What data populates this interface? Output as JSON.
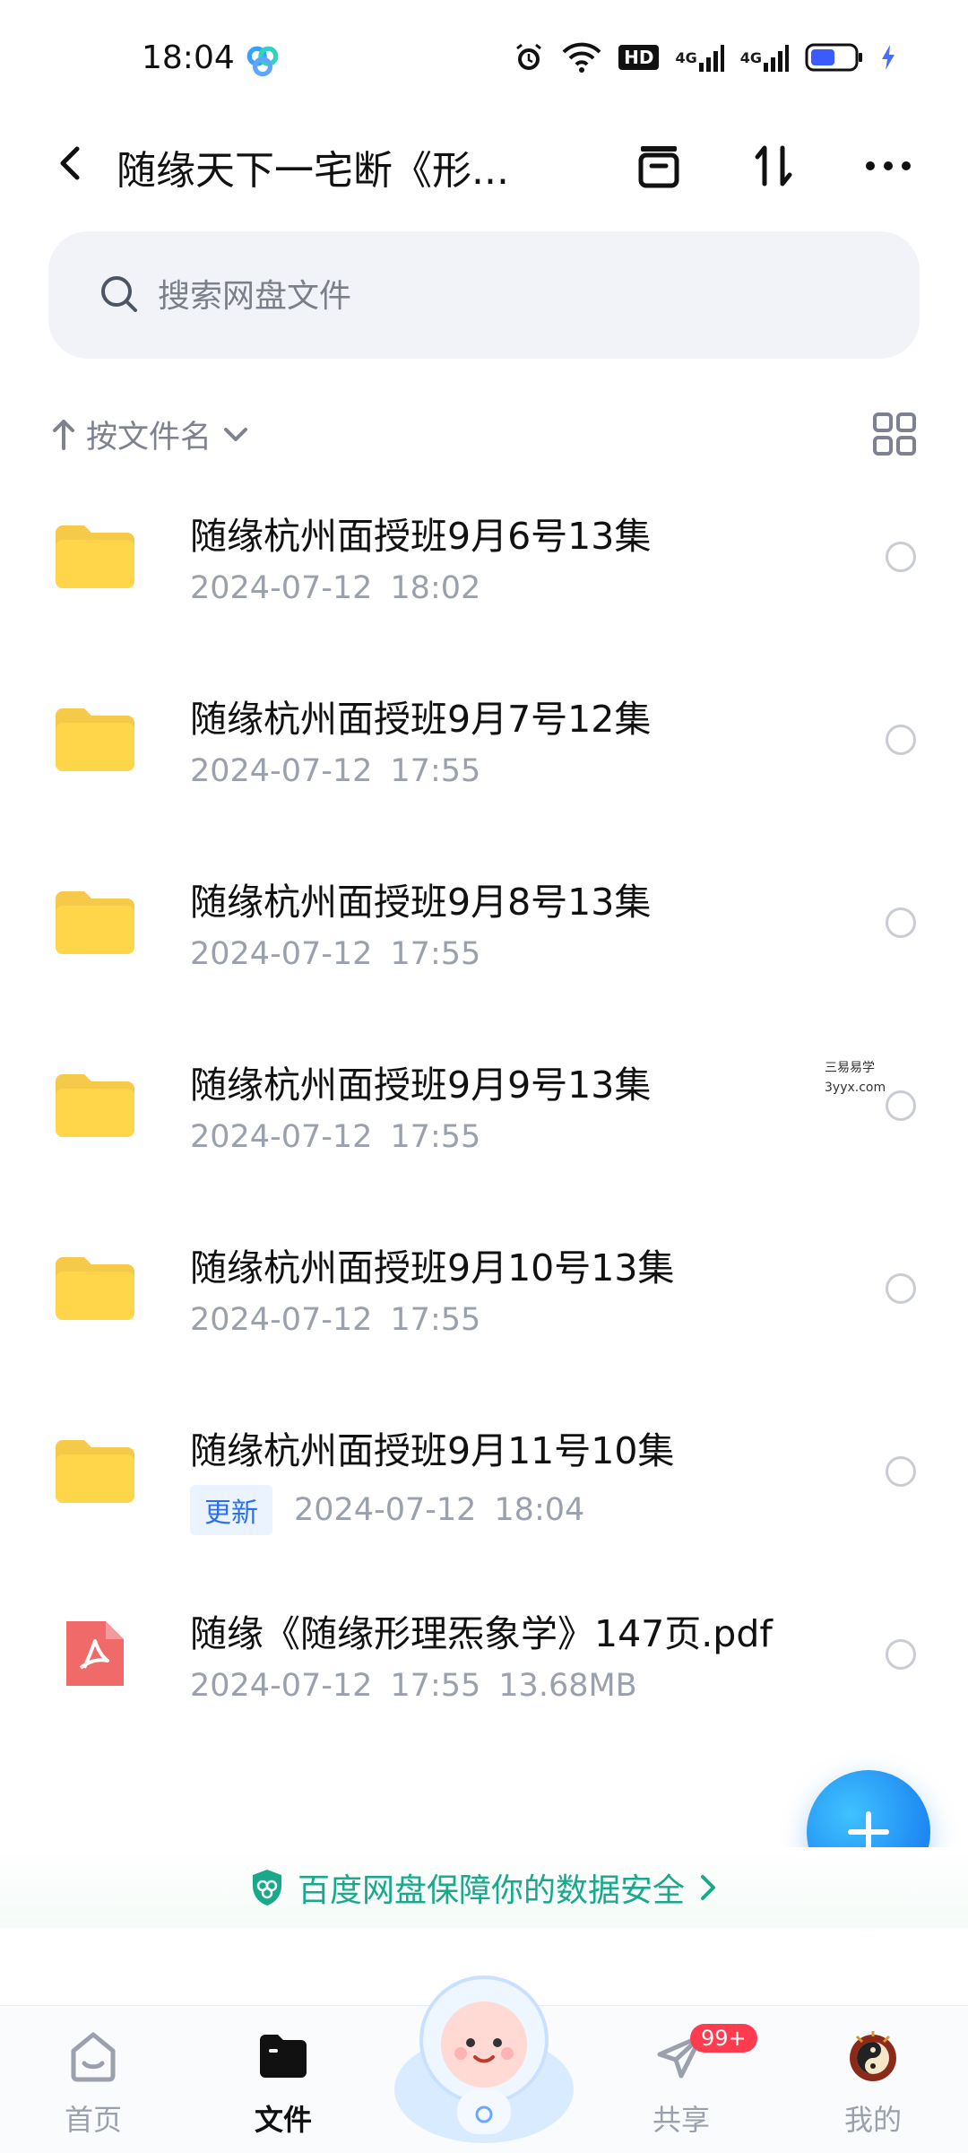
{
  "status_bar": {
    "time": "18:04",
    "app_icon": "baidu-netdisk-icon",
    "icons": [
      "alarm-icon",
      "wifi-icon",
      "hd-icon",
      "signal-4g-icon",
      "signal-4g-icon",
      "battery-icon",
      "charging-icon"
    ],
    "hd_label": "HD",
    "net1": "4G",
    "net2": "4G"
  },
  "header": {
    "title": "随缘天下一宅断《形...",
    "buttons": [
      "archive-icon",
      "sort-icon",
      "more-icon"
    ]
  },
  "search": {
    "placeholder": "搜索网盘文件"
  },
  "sort": {
    "label": "按文件名"
  },
  "files": [
    {
      "name": "随缘杭州面授班9月6号13集",
      "date": "2024-07-12",
      "time": "18:02",
      "type": "folder"
    },
    {
      "name": "随缘杭州面授班9月7号12集",
      "date": "2024-07-12",
      "time": "17:55",
      "type": "folder"
    },
    {
      "name": "随缘杭州面授班9月8号13集",
      "date": "2024-07-12",
      "time": "17:55",
      "type": "folder"
    },
    {
      "name": "随缘杭州面授班9月9号13集",
      "date": "2024-07-12",
      "time": "17:55",
      "type": "folder"
    },
    {
      "name": "随缘杭州面授班9月10号13集",
      "date": "2024-07-12",
      "time": "17:55",
      "type": "folder"
    },
    {
      "name": "随缘杭州面授班9月11号10集",
      "date": "2024-07-12",
      "time": "18:04",
      "type": "folder",
      "badge": "更新"
    },
    {
      "name": "随缘《随缘形理炁象学》147页.pdf",
      "date": "2024-07-12",
      "time": "17:55",
      "size": "13.68MB",
      "type": "pdf"
    }
  ],
  "watermark": {
    "line1": "三易易学",
    "line2": "3yyx.com"
  },
  "security_banner": "百度网盘保障你的数据安全",
  "nav": {
    "home": "首页",
    "files": "文件",
    "share": "共享",
    "share_badge": "99+",
    "me": "我的"
  },
  "colors": {
    "accent": "#1e88f2",
    "folder": "#ffd54a",
    "pdf": "#f06a6a",
    "security": "#1aa88a",
    "badge": "#ff3b4f"
  }
}
